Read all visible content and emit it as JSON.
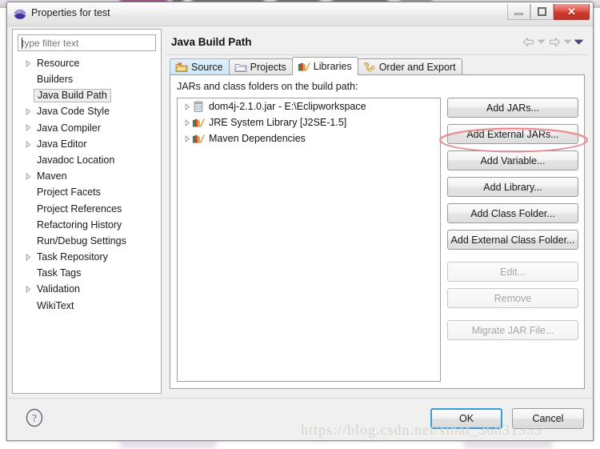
{
  "window": {
    "title": "Properties for test",
    "icon": "eclipse-globe-icon",
    "minimize_label": "",
    "maximize_label": "",
    "close_label": "✕"
  },
  "filter": {
    "value": "",
    "placeholder": "type filter text"
  },
  "sidebar": {
    "items": [
      {
        "label": "Resource",
        "expandable": true,
        "selected": false
      },
      {
        "label": "Builders",
        "expandable": false,
        "selected": false
      },
      {
        "label": "Java Build Path",
        "expandable": false,
        "selected": true
      },
      {
        "label": "Java Code Style",
        "expandable": true,
        "selected": false
      },
      {
        "label": "Java Compiler",
        "expandable": true,
        "selected": false
      },
      {
        "label": "Java Editor",
        "expandable": true,
        "selected": false
      },
      {
        "label": "Javadoc Location",
        "expandable": false,
        "selected": false
      },
      {
        "label": "Maven",
        "expandable": true,
        "selected": false
      },
      {
        "label": "Project Facets",
        "expandable": false,
        "selected": false
      },
      {
        "label": "Project References",
        "expandable": false,
        "selected": false
      },
      {
        "label": "Refactoring History",
        "expandable": false,
        "selected": false
      },
      {
        "label": "Run/Debug Settings",
        "expandable": false,
        "selected": false
      },
      {
        "label": "Task Repository",
        "expandable": true,
        "selected": false
      },
      {
        "label": "Task Tags",
        "expandable": false,
        "selected": false
      },
      {
        "label": "Validation",
        "expandable": true,
        "selected": false
      },
      {
        "label": "WikiText",
        "expandable": false,
        "selected": false
      }
    ]
  },
  "page": {
    "title": "Java Build Path",
    "nav": {
      "back_icon": "back-arrow-icon",
      "back_menu_icon": "chevron-down-icon",
      "forward_icon": "forward-arrow-icon",
      "forward_menu_icon": "chevron-down-icon",
      "more_icon": "chevron-down-filled-icon"
    }
  },
  "tabs": [
    {
      "label": "Source",
      "icon": "source-folder-icon",
      "active": false,
      "highlighted": true
    },
    {
      "label": "Projects",
      "icon": "projects-icon",
      "active": false,
      "highlighted": false
    },
    {
      "label": "Libraries",
      "icon": "libraries-books-icon",
      "active": true,
      "highlighted": false
    },
    {
      "label": "Order and Export",
      "icon": "order-export-icon",
      "active": false,
      "highlighted": false
    }
  ],
  "libraries_panel": {
    "label": "JARs and class folders on the build path:",
    "entries": [
      {
        "label": "dom4j-2.1.0.jar - E:\\Eclipworkspace",
        "icon": "jar-icon",
        "expandable": true
      },
      {
        "label": "JRE System Library [J2SE-1.5]",
        "icon": "library-icon",
        "expandable": true
      },
      {
        "label": "Maven Dependencies",
        "icon": "library-icon",
        "expandable": true
      }
    ],
    "buttons": [
      {
        "label": "Add JARs...",
        "enabled": true,
        "group": 1
      },
      {
        "label": "Add External JARs...",
        "enabled": true,
        "group": 1
      },
      {
        "label": "Add Variable...",
        "enabled": true,
        "group": 1
      },
      {
        "label": "Add Library...",
        "enabled": true,
        "group": 1
      },
      {
        "label": "Add Class Folder...",
        "enabled": true,
        "group": 1
      },
      {
        "label": "Add External Class Folder...",
        "enabled": true,
        "group": 1
      },
      {
        "label": "Edit...",
        "enabled": false,
        "group": 2
      },
      {
        "label": "Remove",
        "enabled": false,
        "group": 2
      },
      {
        "label": "Migrate JAR File...",
        "enabled": false,
        "group": 3
      }
    ]
  },
  "footer": {
    "help_icon": "help-question-icon",
    "ok_label": "OK",
    "cancel_label": "Cancel"
  },
  "annotation": {
    "shape": "red-ellipse",
    "target": "Add External JARs...",
    "color": "#e2848a"
  },
  "watermark": {
    "text": "https://blog.csdn.net/sinat_36831355",
    "color": "#d8d3cc"
  }
}
